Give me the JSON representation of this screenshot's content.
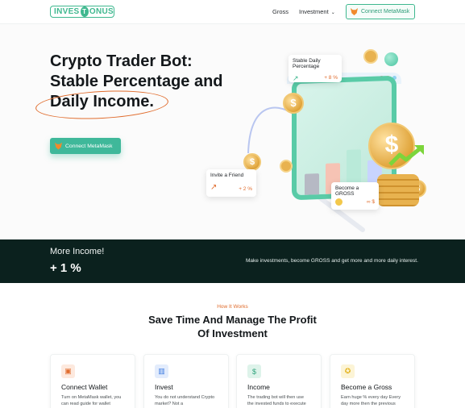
{
  "header": {
    "logo_left": "INVES",
    "logo_t": "T",
    "logo_right": "ONUS",
    "nav": {
      "gross": "Gross",
      "investment": "Investment"
    },
    "connect_button": "Connect MetaMask"
  },
  "hero": {
    "title_line1": "Crypto Trader Bot:",
    "title_line2": "Stable Percentage and",
    "title_line3": "Daily Income.",
    "connect_button": "Connect MetaMask"
  },
  "illustration": {
    "card_stable": {
      "title_line1": "Stable Daily",
      "title_line2": "Percentage",
      "value": "+ 8 %"
    },
    "card_invite": {
      "title": "Invite a Friend",
      "value": "+ 2 %"
    },
    "card_gross": {
      "title_line1": "Become a",
      "title_line2": "GROSS",
      "value": "∞ $"
    },
    "coin_symbol": "$"
  },
  "strip": {
    "title": "More Income!",
    "value": "+ 1 %",
    "description": "Make investments, become GROSS and get more and more daily interest."
  },
  "how_it_works": {
    "label": "How It Works",
    "title_line1": "Save Time And Manage The Profit",
    "title_line2": "Of Investment"
  },
  "cards": [
    {
      "title": "Connect Wallet",
      "desc": "Turn on MetaMask wallet, you can read guide for wallet below.",
      "icon": "wallet-icon",
      "color": "#e06c2d"
    },
    {
      "title": "Invest",
      "desc": "You do not understand Crypto market? Not a",
      "icon": "chart-icon",
      "color": "#3d7be0"
    },
    {
      "title": "Income",
      "desc": "The trading bot will then use the invested funds to execute",
      "icon": "money-icon",
      "color": "#2fa37c"
    },
    {
      "title": "Become a Gross",
      "desc": "Earn huge % every day Every day more then the previous one.",
      "icon": "medal-icon",
      "color": "#e3b21c"
    }
  ]
}
